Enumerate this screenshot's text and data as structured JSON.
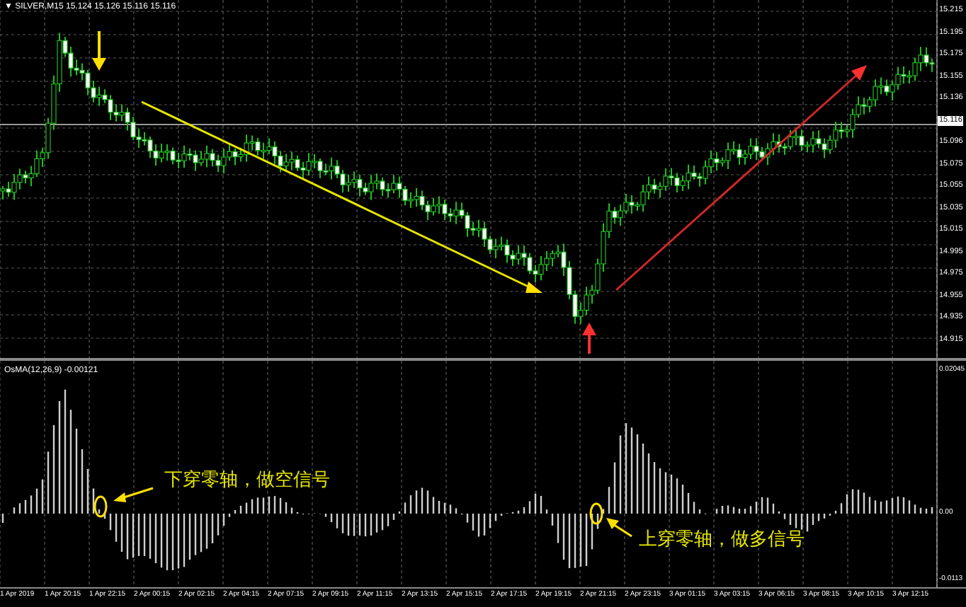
{
  "chart_title": "▼ SILVER,M15  15.124 15.126 15.116 15.116",
  "price_axis": [
    {
      "label": "15.215",
      "kind": "tick"
    },
    {
      "label": "15.195",
      "kind": "tick"
    },
    {
      "label": "15.175",
      "kind": "tick"
    },
    {
      "label": "15.155",
      "kind": "tick"
    },
    {
      "label": "15.136",
      "kind": "tick"
    },
    {
      "label": "15.116",
      "kind": "current"
    },
    {
      "label": "15.096",
      "kind": "tick"
    },
    {
      "label": "15.075",
      "kind": "tick"
    },
    {
      "label": "15.055",
      "kind": "tick"
    },
    {
      "label": "15.035",
      "kind": "tick"
    },
    {
      "label": "15.015",
      "kind": "tick"
    },
    {
      "label": "14.995",
      "kind": "tick"
    },
    {
      "label": "14.975",
      "kind": "tick"
    },
    {
      "label": "14.955",
      "kind": "tick"
    },
    {
      "label": "14.935",
      "kind": "tick"
    },
    {
      "label": "14.915",
      "kind": "tick"
    }
  ],
  "indicator": {
    "label": "OsMA(12,26,9) -0.00121",
    "axis": [
      "0.02045",
      "0.00",
      "-0.0113"
    ]
  },
  "annotations": [
    {
      "text": "下穿零轴，做空信号"
    },
    {
      "text": "上穿零轴，做多信号"
    }
  ],
  "time_axis": [
    "1 Apr 2019",
    "1 Apr 20:15",
    "1 Apr 22:15",
    "2 Apr 00:15",
    "2 Apr 02:15",
    "2 Apr 04:15",
    "2 Apr 07:15",
    "2 Apr 09:15",
    "2 Apr 11:15",
    "2 Apr 13:15",
    "2 Apr 15:15",
    "2 Apr 17:15",
    "2 Apr 19:15",
    "2 Apr 21:15",
    "2 Apr 23:15",
    "3 Apr 01:15",
    "3 Apr 03:15",
    "3 Apr 06:15",
    "3 Apr 08:15",
    "3 Apr 10:15",
    "3 Apr 12:15"
  ]
}
